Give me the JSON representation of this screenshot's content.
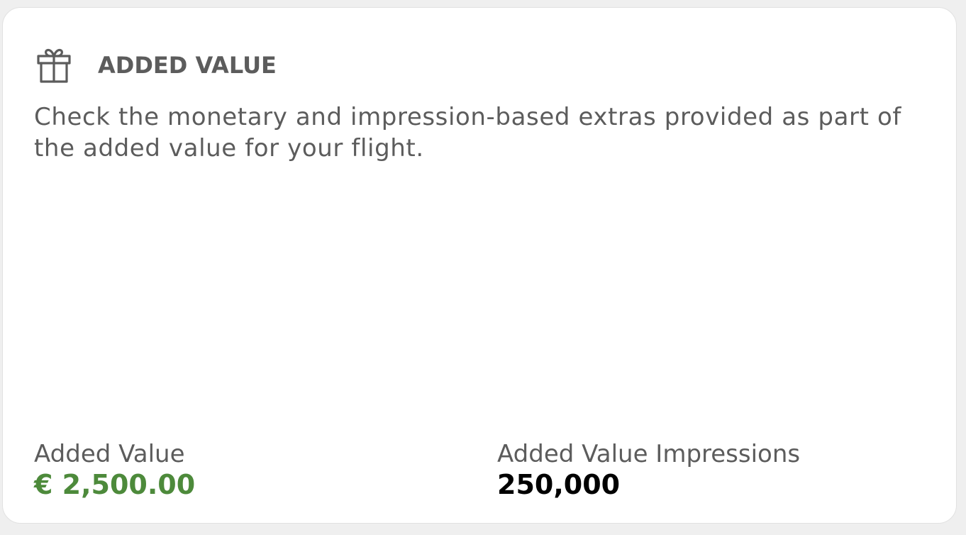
{
  "card": {
    "icon": "gift-icon",
    "title": "ADDED VALUE",
    "description": "Check the monetary and impression-based extras provided as part of the added value for your flight."
  },
  "metrics": {
    "added_value": {
      "label": "Added Value",
      "value": "€ 2,500.00",
      "color": "#4d8a3b"
    },
    "added_value_impressions": {
      "label": "Added Value Impressions",
      "value": "250,000",
      "color": "#000000"
    }
  },
  "colors": {
    "text_secondary": "#5c5c5c",
    "card_background": "#ffffff",
    "page_background": "#efefef"
  }
}
